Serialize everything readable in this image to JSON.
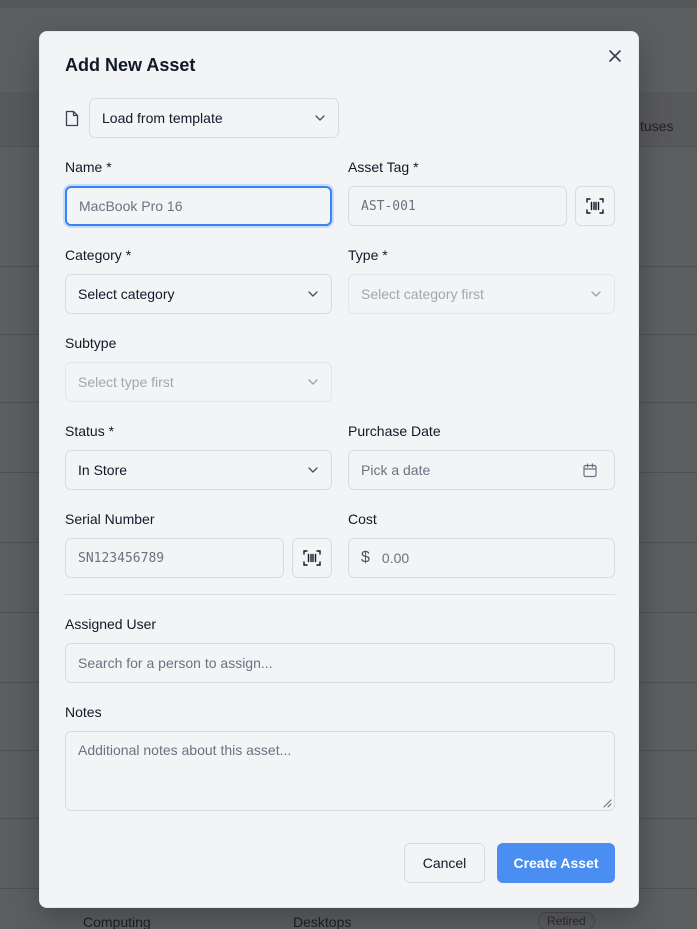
{
  "background": {
    "statuses_label": "tuses",
    "row_category": "Computing",
    "row_type": "Desktops",
    "row_status": "Retired"
  },
  "dialog": {
    "title": "Add New Asset",
    "template": {
      "label": "Load from template"
    },
    "name": {
      "label": "Name *",
      "value": "MacBook Pro 16"
    },
    "asset_tag": {
      "label": "Asset Tag *",
      "placeholder": "AST-001"
    },
    "category": {
      "label": "Category *",
      "value": "Select category"
    },
    "type": {
      "label": "Type *",
      "value": "Select category first"
    },
    "subtype": {
      "label": "Subtype",
      "value": "Select type first"
    },
    "status": {
      "label": "Status *",
      "value": "In Store"
    },
    "purchase_date": {
      "label": "Purchase Date",
      "placeholder": "Pick a date"
    },
    "serial_number": {
      "label": "Serial Number",
      "placeholder": "SN123456789"
    },
    "cost": {
      "label": "Cost",
      "currency": "$",
      "placeholder": "0.00"
    },
    "assigned_user": {
      "label": "Assigned User",
      "placeholder": "Search for a person to assign..."
    },
    "notes": {
      "label": "Notes",
      "placeholder": "Additional notes about this asset..."
    },
    "cancel_label": "Cancel",
    "create_label": "Create Asset"
  },
  "colors": {
    "accent": "#4a8ef2",
    "focus_ring": "#3b82f6",
    "dialog_bg": "#f3f4f6"
  }
}
